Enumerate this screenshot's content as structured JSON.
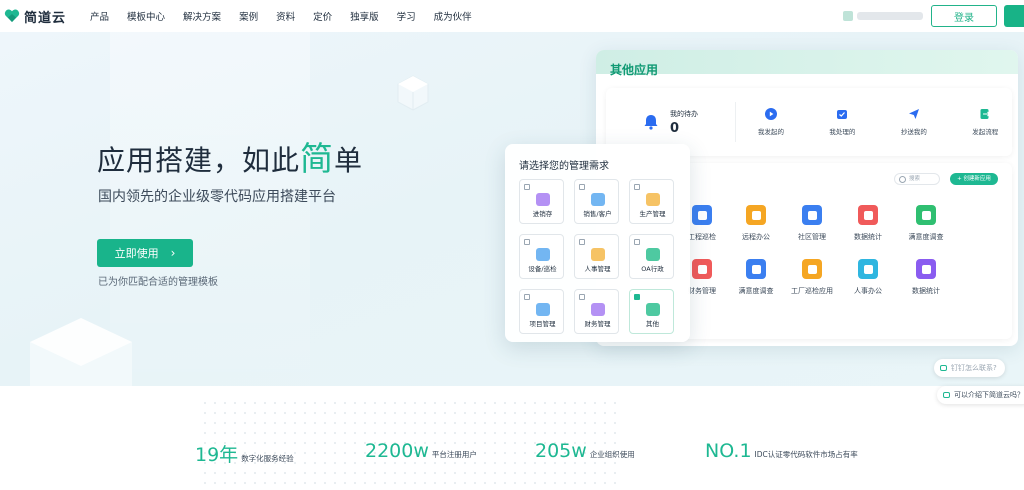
{
  "brand": {
    "name": "简道云"
  },
  "nav": {
    "items": [
      "产品",
      "模板中心",
      "解决方案",
      "案例",
      "资料",
      "定价",
      "独享版",
      "学习",
      "成为伙伴"
    ],
    "login": "登录"
  },
  "hero": {
    "title_prefix": "应用搭建，如此",
    "title_accent": "简",
    "title_suffix": "单",
    "subtitle": "国内领先的企业级零代码应用搭建平台",
    "cta": "立即使用",
    "note": "已为你匹配合适的管理模板"
  },
  "apps_panel": {
    "title": "其他应用",
    "todo_label": "我的待办",
    "todo_count": "0",
    "todo_actions": [
      {
        "label": "我发起的",
        "icon": "play-icon"
      },
      {
        "label": "我处理的",
        "icon": "inbox-icon"
      },
      {
        "label": "抄送我的",
        "icon": "send-icon"
      },
      {
        "label": "发起流程",
        "icon": "flow-icon"
      }
    ],
    "search_placeholder": "搜索",
    "new_app": "+ 创建新应用",
    "apps": [
      {
        "label": "工程巡检",
        "color": "#3b7ff0"
      },
      {
        "label": "远程办公",
        "color": "#f5a623"
      },
      {
        "label": "社区管理",
        "color": "#3b7ff0"
      },
      {
        "label": "数据统计",
        "color": "#f05a5a"
      },
      {
        "label": "满意度调查",
        "color": "#2fbf71"
      },
      {
        "label": "财务管理",
        "color": "#f05a5a"
      },
      {
        "label": "满意度调查",
        "color": "#3b7ff0"
      },
      {
        "label": "工厂巡检应用",
        "color": "#f5a623"
      },
      {
        "label": "人事办公",
        "color": "#2fb6e0"
      },
      {
        "label": "数据统计",
        "color": "#8a5cf0"
      }
    ]
  },
  "needs_card": {
    "title": "请选择您的管理需求",
    "options": [
      {
        "label": "进销存",
        "checked": false,
        "color": "#a77ef2"
      },
      {
        "label": "销售/客户",
        "checked": false,
        "color": "#5aa9f0"
      },
      {
        "label": "生产管理",
        "checked": false,
        "color": "#f5b84a"
      },
      {
        "label": "设备/巡检",
        "checked": false,
        "color": "#5aa9f0"
      },
      {
        "label": "人事管理",
        "checked": false,
        "color": "#f5b84a"
      },
      {
        "label": "OA行政",
        "checked": false,
        "color": "#2fbf91"
      },
      {
        "label": "项目管理",
        "checked": false,
        "color": "#5aa9f0"
      },
      {
        "label": "财务管理",
        "checked": false,
        "color": "#a77ef2"
      },
      {
        "label": "其他",
        "checked": true,
        "color": "#2fbf91"
      }
    ]
  },
  "chat": {
    "bubble1": "钉钉怎么联系?",
    "bubble2": "可以介绍下简道云吗？"
  },
  "stats": [
    {
      "value": "19年",
      "desc": "数字化服务经验"
    },
    {
      "value": "2200w",
      "desc": "平台注册用户"
    },
    {
      "value": "205w",
      "desc": "企业组织使用"
    },
    {
      "value": "NO.1",
      "desc": "IDC认证零代码软件市场占有率"
    }
  ]
}
